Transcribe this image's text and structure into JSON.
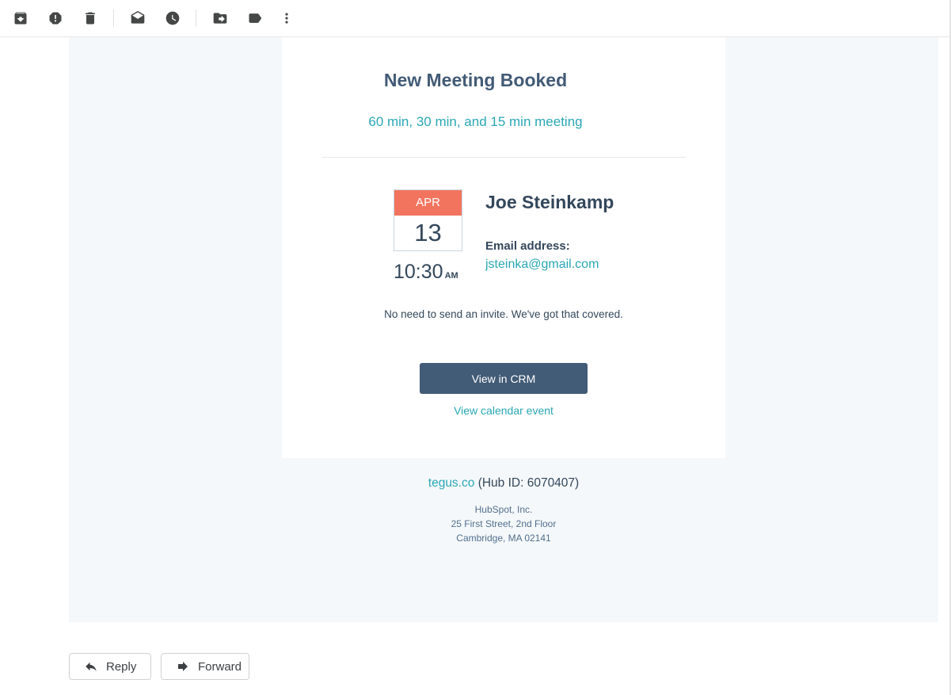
{
  "toolbar": {
    "icons": [
      "archive-icon",
      "report-spam-icon",
      "delete-icon",
      "mark-unread-icon",
      "snooze-icon",
      "move-to-icon",
      "label-icon",
      "more-icon"
    ]
  },
  "email": {
    "title": "New Meeting Booked",
    "subtitle": "60 min, 30 min, and 15 min meeting",
    "calendar": {
      "month": "APR",
      "day": "13",
      "time": "10:30",
      "ampm": "AM"
    },
    "contact": {
      "name": "Joe Steinkamp",
      "email_label": "Email address:",
      "email": "jsteinka@gmail.com"
    },
    "note": "No need to send an invite. We've got that covered.",
    "crm_button": "View in CRM",
    "calendar_link": "View calendar event",
    "footer": {
      "hub_link": "tegus.co",
      "hub_id": "(Hub ID: 6070407)",
      "company": "HubSpot, Inc.",
      "street": "25 First Street, 2nd Floor",
      "city": "Cambridge, MA 02141"
    }
  },
  "actions": {
    "reply": "Reply",
    "forward": "Forward"
  },
  "colors": {
    "accent": "#2aa7b5",
    "heading": "#425b76",
    "calendar_header": "#f2745f",
    "button": "#425b76"
  }
}
